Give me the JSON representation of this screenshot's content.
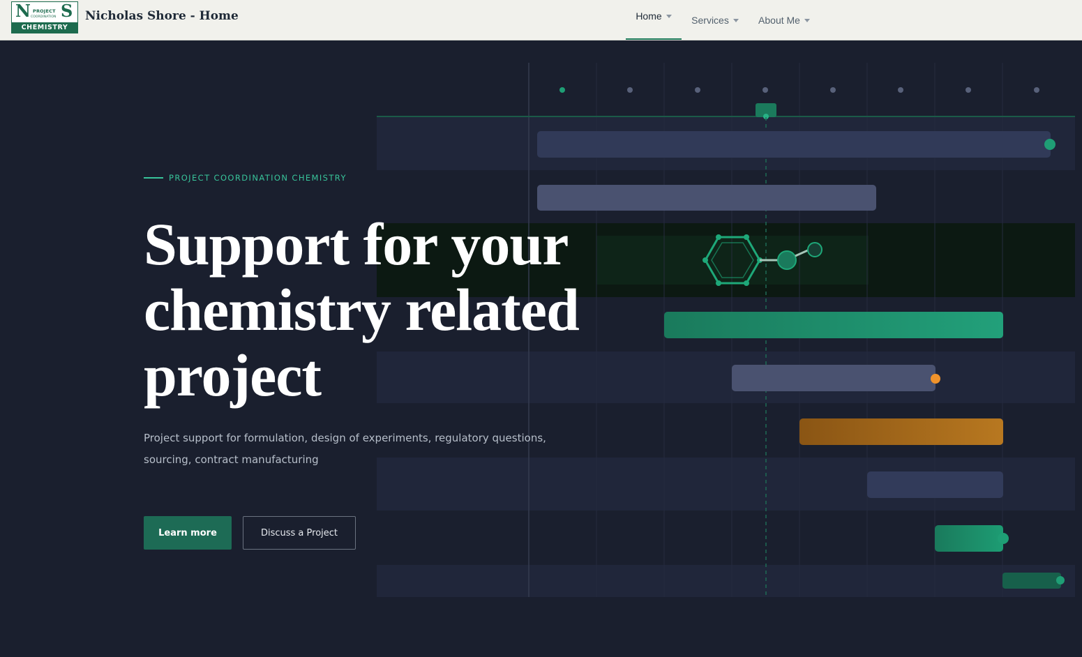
{
  "header": {
    "logo": {
      "letter_left": "N",
      "letter_right": "S",
      "line1": "PROJECT",
      "line2": "COORDINATION",
      "band": "CHEMISTRY"
    },
    "site_title": "Nicholas Shore - Home",
    "nav": [
      {
        "label": "Home",
        "active": true
      },
      {
        "label": "Services",
        "active": false
      },
      {
        "label": "About Me",
        "active": false
      }
    ]
  },
  "hero": {
    "eyebrow": "PROJECT COORDINATION CHEMISTRY",
    "headline_line1": "Support for your",
    "headline_line2": "chemistry related",
    "headline_line3": "project",
    "subtitle": "Project support for formulation, design of experiments, regulatory questions, sourcing, contract manufacturing",
    "primary_button": "Learn more",
    "secondary_button": "Discuss a Project"
  },
  "colors": {
    "background": "#1a1f2e",
    "accent_green": "#1f9e75",
    "accent_orange": "#c37a22",
    "header_bg": "#f1f1ec"
  }
}
